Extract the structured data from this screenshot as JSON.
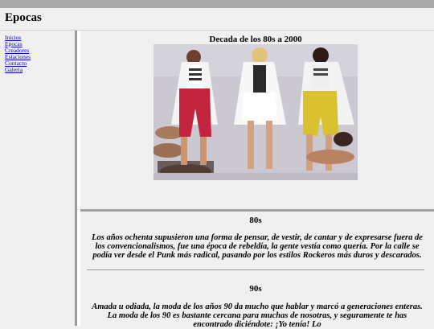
{
  "header": {
    "title": "Epocas"
  },
  "sidebar": {
    "links": [
      "Inicios",
      "Epocas",
      "Creadores",
      "Estaciones",
      "Contacto",
      "Galeria"
    ]
  },
  "main": {
    "gallery_title": "Decada de los 80s a 2000",
    "sections": [
      {
        "title": "80s",
        "text": "Los años ochenta supusieron una forma de pensar, de vestir, de cantar y de expresarse fuera de los convencionalismos, fue una época de rebeldía, la gente vestía como quería. Por la calle se podía ver desde el Punk más radical, pasando por los estilos Rockeros más duros y descarados."
      },
      {
        "title": "90s",
        "text": "Amada u odiada, la moda de los años 90 da mucho que hablar y marcó a generaciones enteras. La moda de los 90 es bastante cercana para muchas de nosotras, y seguramente te has encontrado diciéndote: ¡Yo tenía! Lo"
      }
    ]
  },
  "colors": {
    "topbar": "#a9a9a9",
    "background": "#f0f0f0",
    "link": "#0000ee",
    "separator": "#9c9c9c"
  }
}
